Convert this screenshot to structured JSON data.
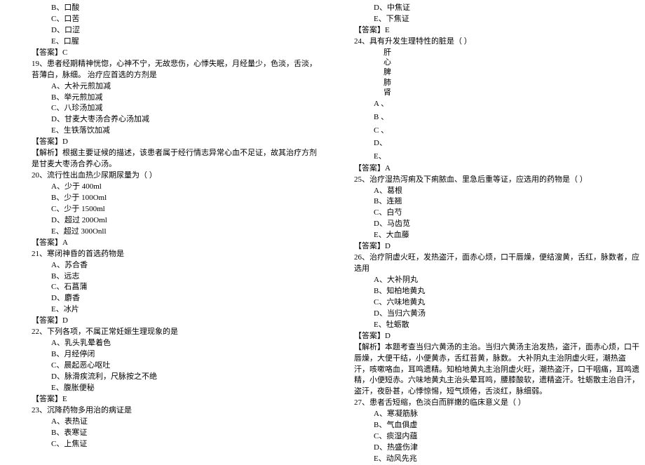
{
  "left": {
    "q18_opts": {
      "B": "B、口酸",
      "C": "C、口苦",
      "D": "D、口涩",
      "E": "E、口腥"
    },
    "q18_ans": "【答案】C",
    "q19_text": "19、患者经期精神恍惚，心神不宁，无故悲伤，心悸失眠，月经量少，色淡，舌淡，苔薄白，脉细。 治疗应首选的方剂是",
    "q19_opts": {
      "A": "A、大补元煎加减",
      "B": "B、举元煎加减",
      "C": "C、八珍汤加减",
      "D": "D、甘麦大枣汤合养心汤加减",
      "E": "E、生铁落饮加减"
    },
    "q19_ans": "【答案】D",
    "q19_exp": "【解析】根据主要证候的描述，该患者属于经行情志异常心血不足证，故其治疗方剂是甘麦大枣汤合养心汤。",
    "q20_text": "20、流行性出血热少尿期尿量为（ ）",
    "q20_opts": {
      "A": "A、少于 400ml",
      "B": "B、少于 100Oml",
      "C": "C、少于 1500ml",
      "D": "D、超过 200Oml",
      "E": "E、超过 300Onll"
    },
    "q20_ans": "【答案】A",
    "q21_text": "21、寒闭神昏的首选药物是",
    "q21_opts": {
      "A": "A、苏合香",
      "B": "B、远志",
      "C": "C、石菖蒲",
      "D": "D、麝香",
      "E": "E、冰片"
    },
    "q21_ans": "【答案】D",
    "q22_text": "22、下列各项，不属正常妊娠生理现象的是",
    "q22_opts": {
      "A": "A、乳头乳晕着色",
      "B": "B、月经停闭",
      "C": "C、晨起恶心呕吐",
      "D": "D、脉滑疾流利，尺脉按之不绝",
      "E": "E、腹胀便秘"
    },
    "q22_ans": "【答案】E",
    "q23_text": "23、沉降药物多用治的病证是",
    "q23_opts": {
      "A": "A、表热证",
      "B": "B、表寒证",
      "C": "C、上焦证"
    }
  },
  "right": {
    "q23_opts": {
      "D": "D、中焦证",
      "E": "E、下焦证"
    },
    "q23_ans": "【答案】E",
    "q24_text": "24、具有升发生理特性的脏是（ ）",
    "q24_v": {
      "a": "肝",
      "b": "心",
      "c": "脾",
      "d": "肺",
      "e": "肾"
    },
    "q24_opts": {
      "A": "A 、",
      "B": "B 、",
      "C": "C 、",
      "D": "D、",
      "E": "E、"
    },
    "q24_ans": "【答案】A",
    "q25_text": "25、治疗湿热泻痢及下痢脓血、里急后重等证，应选用的药物是（ ）",
    "q25_opts": {
      "A": "A、葛根",
      "B": "B、连翘",
      "C": "C、白芍",
      "D": "D、马齿苋",
      "E": "E、大血藤"
    },
    "q25_ans": "【答案】D",
    "q26_text": "26、治疗阴虚火旺，发热盗汗，面赤心烦，口干唇燥，便结溲黄，舌红，脉数者，应选用",
    "q26_opts": {
      "A": "A、大补阴丸",
      "B": "B、知柏地黄丸",
      "C": "C、六味地黄丸",
      "D": "D、当归六黄汤",
      "E": "E、牡蛎散"
    },
    "q26_ans": "【答案】D",
    "q26_exp": "【解析】本题考查当归六黄汤的主治。当归六黄汤主治发热，盗汗，面赤心烦，口干唇燥，大便干结，小便黄赤，舌红苔黄，脉数。 大补阴丸主治阴虚火旺，潮热盗汗，咳嗽咯血，耳鸣遗精。知柏地黄丸主治阴虚火旺，潮热盗汗，口干咽痛，耳鸣遗精，小便短赤。六味地黄丸主治头晕耳鸣，腰膝酸软，遗精盗汗。牡蛎散主治自汗，盗汗，夜卧甚，心悸惊惕，短气烦倦，舌淡红，脉细弱。",
    "q27_text": "27、患者舌短缩，色淡白而胖嫩的临床意义是（ ）",
    "q27_opts": {
      "A": "A、寒凝筋脉",
      "B": "B、气血俱虚",
      "C": "C、痰湿内蕴",
      "D": "D、热盛伤津",
      "E": "E、动风先兆"
    }
  }
}
